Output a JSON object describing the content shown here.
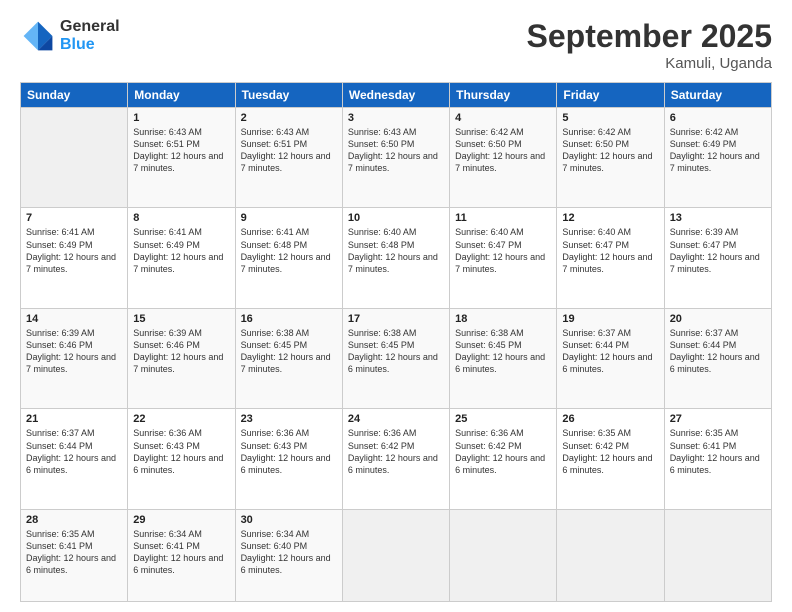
{
  "logo": {
    "general": "General",
    "blue": "Blue"
  },
  "title": "September 2025",
  "location": "Kamuli, Uganda",
  "headers": [
    "Sunday",
    "Monday",
    "Tuesday",
    "Wednesday",
    "Thursday",
    "Friday",
    "Saturday"
  ],
  "weeks": [
    [
      {
        "day": "",
        "info": ""
      },
      {
        "day": "1",
        "info": "Sunrise: 6:43 AM\nSunset: 6:51 PM\nDaylight: 12 hours\nand 7 minutes."
      },
      {
        "day": "2",
        "info": "Sunrise: 6:43 AM\nSunset: 6:51 PM\nDaylight: 12 hours\nand 7 minutes."
      },
      {
        "day": "3",
        "info": "Sunrise: 6:43 AM\nSunset: 6:50 PM\nDaylight: 12 hours\nand 7 minutes."
      },
      {
        "day": "4",
        "info": "Sunrise: 6:42 AM\nSunset: 6:50 PM\nDaylight: 12 hours\nand 7 minutes."
      },
      {
        "day": "5",
        "info": "Sunrise: 6:42 AM\nSunset: 6:50 PM\nDaylight: 12 hours\nand 7 minutes."
      },
      {
        "day": "6",
        "info": "Sunrise: 6:42 AM\nSunset: 6:49 PM\nDaylight: 12 hours\nand 7 minutes."
      }
    ],
    [
      {
        "day": "7",
        "info": "Sunrise: 6:41 AM\nSunset: 6:49 PM\nDaylight: 12 hours\nand 7 minutes."
      },
      {
        "day": "8",
        "info": "Sunrise: 6:41 AM\nSunset: 6:49 PM\nDaylight: 12 hours\nand 7 minutes."
      },
      {
        "day": "9",
        "info": "Sunrise: 6:41 AM\nSunset: 6:48 PM\nDaylight: 12 hours\nand 7 minutes."
      },
      {
        "day": "10",
        "info": "Sunrise: 6:40 AM\nSunset: 6:48 PM\nDaylight: 12 hours\nand 7 minutes."
      },
      {
        "day": "11",
        "info": "Sunrise: 6:40 AM\nSunset: 6:47 PM\nDaylight: 12 hours\nand 7 minutes."
      },
      {
        "day": "12",
        "info": "Sunrise: 6:40 AM\nSunset: 6:47 PM\nDaylight: 12 hours\nand 7 minutes."
      },
      {
        "day": "13",
        "info": "Sunrise: 6:39 AM\nSunset: 6:47 PM\nDaylight: 12 hours\nand 7 minutes."
      }
    ],
    [
      {
        "day": "14",
        "info": "Sunrise: 6:39 AM\nSunset: 6:46 PM\nDaylight: 12 hours\nand 7 minutes."
      },
      {
        "day": "15",
        "info": "Sunrise: 6:39 AM\nSunset: 6:46 PM\nDaylight: 12 hours\nand 7 minutes."
      },
      {
        "day": "16",
        "info": "Sunrise: 6:38 AM\nSunset: 6:45 PM\nDaylight: 12 hours\nand 7 minutes."
      },
      {
        "day": "17",
        "info": "Sunrise: 6:38 AM\nSunset: 6:45 PM\nDaylight: 12 hours\nand 6 minutes."
      },
      {
        "day": "18",
        "info": "Sunrise: 6:38 AM\nSunset: 6:45 PM\nDaylight: 12 hours\nand 6 minutes."
      },
      {
        "day": "19",
        "info": "Sunrise: 6:37 AM\nSunset: 6:44 PM\nDaylight: 12 hours\nand 6 minutes."
      },
      {
        "day": "20",
        "info": "Sunrise: 6:37 AM\nSunset: 6:44 PM\nDaylight: 12 hours\nand 6 minutes."
      }
    ],
    [
      {
        "day": "21",
        "info": "Sunrise: 6:37 AM\nSunset: 6:44 PM\nDaylight: 12 hours\nand 6 minutes."
      },
      {
        "day": "22",
        "info": "Sunrise: 6:36 AM\nSunset: 6:43 PM\nDaylight: 12 hours\nand 6 minutes."
      },
      {
        "day": "23",
        "info": "Sunrise: 6:36 AM\nSunset: 6:43 PM\nDaylight: 12 hours\nand 6 minutes."
      },
      {
        "day": "24",
        "info": "Sunrise: 6:36 AM\nSunset: 6:42 PM\nDaylight: 12 hours\nand 6 minutes."
      },
      {
        "day": "25",
        "info": "Sunrise: 6:36 AM\nSunset: 6:42 PM\nDaylight: 12 hours\nand 6 minutes."
      },
      {
        "day": "26",
        "info": "Sunrise: 6:35 AM\nSunset: 6:42 PM\nDaylight: 12 hours\nand 6 minutes."
      },
      {
        "day": "27",
        "info": "Sunrise: 6:35 AM\nSunset: 6:41 PM\nDaylight: 12 hours\nand 6 minutes."
      }
    ],
    [
      {
        "day": "28",
        "info": "Sunrise: 6:35 AM\nSunset: 6:41 PM\nDaylight: 12 hours\nand 6 minutes."
      },
      {
        "day": "29",
        "info": "Sunrise: 6:34 AM\nSunset: 6:41 PM\nDaylight: 12 hours\nand 6 minutes."
      },
      {
        "day": "30",
        "info": "Sunrise: 6:34 AM\nSunset: 6:40 PM\nDaylight: 12 hours\nand 6 minutes."
      },
      {
        "day": "",
        "info": ""
      },
      {
        "day": "",
        "info": ""
      },
      {
        "day": "",
        "info": ""
      },
      {
        "day": "",
        "info": ""
      }
    ]
  ]
}
